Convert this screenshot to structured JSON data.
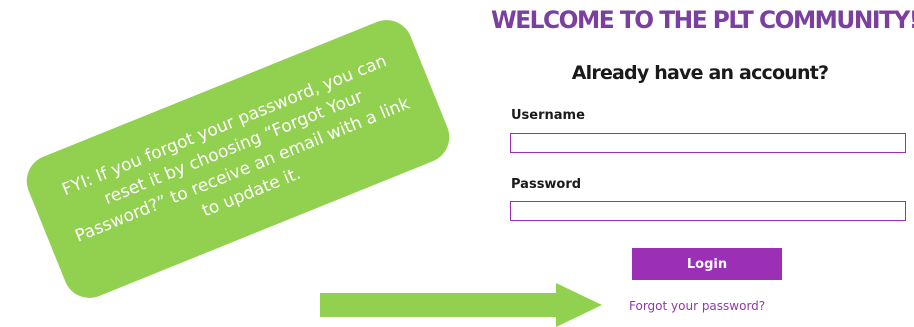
{
  "login": {
    "welcome_title": "WELCOME TO THE PLT COMMUNITY!",
    "subheading": "Already have an account?",
    "username_label": "Username",
    "username_value": "",
    "password_label": "Password",
    "password_value": "",
    "login_button_label": "Login",
    "forgot_password_link": "Forgot your password?"
  },
  "callout": {
    "text": "FYI: If you forgot your password, you can reset it by choosing “Forgot Your Password?” to receive an email with a link to update it."
  },
  "arrow": {
    "icon": "right-arrow-icon",
    "direction": "right"
  },
  "colors": {
    "brand_purple": "#7b3fa0",
    "button_purple": "#9b2fb6",
    "link_purple": "#8e3aa8",
    "callout_green": "#92d050",
    "arrow_green": "#92d050"
  }
}
